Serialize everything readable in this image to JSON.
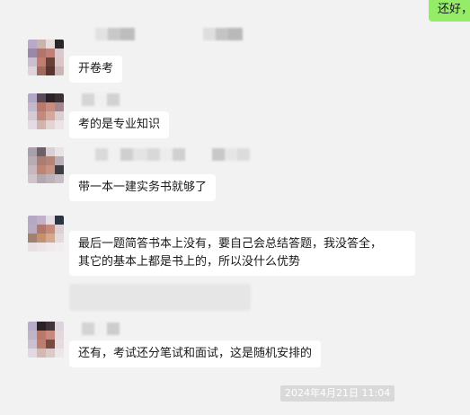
{
  "messages": {
    "right_partial": "还好，",
    "m1": "开卷考",
    "m2": "考的是专业知识",
    "m3": "带一本一建实务书就够了",
    "m4_line1": "最后一题简答书本上没有，要自己会总结答题，我没答全，",
    "m4_line2": "其它的基本上都是书上的，所以没什么优势",
    "m5": "还有，考试还分笔试和面试，这是随机安排的"
  },
  "timestamp": "2024年4月21日 11:04",
  "colors": {
    "background": "#f2f2f2",
    "bubble_received": "#ffffff",
    "bubble_sent": "#95ec69",
    "timestamp_bg": "#d9d9d9"
  }
}
